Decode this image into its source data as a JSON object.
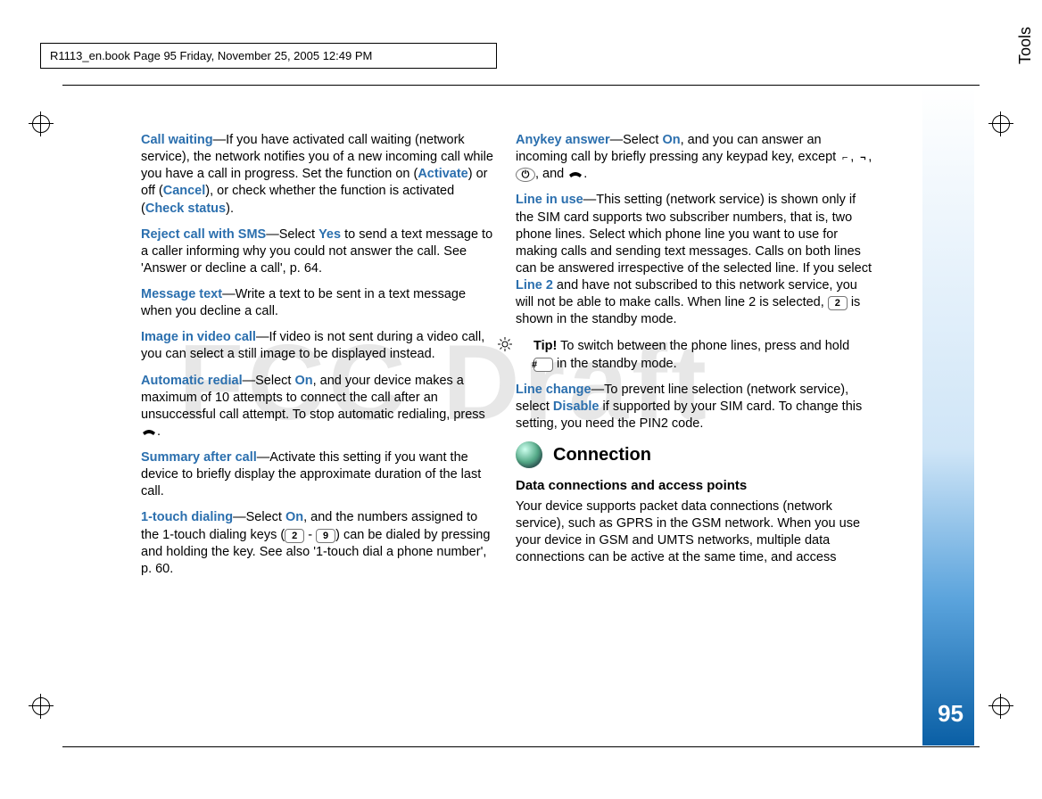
{
  "frame_header": "R1113_en.book  Page 95  Friday, November 25, 2005  12:49 PM",
  "watermark": "FCC Draft",
  "side": {
    "label": "Tools",
    "page": "95"
  },
  "col1": {
    "p1_term": "Call waiting",
    "p1_body": "—If you have activated call waiting (network service), the network notifies you of a new incoming call while you have a call in progress. Set the function on (",
    "p1_opt1": "Activate",
    "p1_mid1": ") or off (",
    "p1_opt2": "Cancel",
    "p1_mid2": "), or check whether the function is activated (",
    "p1_opt3": "Check status",
    "p1_end": ").",
    "p2_term": "Reject call with SMS",
    "p2_body": "—Select ",
    "p2_opt": "Yes",
    "p2_rest": " to send a text message to a caller informing why you could not answer the call. See 'Answer or decline a call', p. 64.",
    "p3_term": "Message text",
    "p3_body": "—Write a text to be sent in a text message when you decline a call.",
    "p4_term": "Image in video call",
    "p4_body": "—If video is not sent during a video call, you can select a still image to be displayed instead.",
    "p5_term": "Automatic redial",
    "p5_body": "—Select ",
    "p5_opt": "On",
    "p5_rest": ", and your device makes a maximum of 10 attempts to connect the call after an unsuccessful call attempt. To stop automatic redialing, press ",
    "p5_end": ".",
    "p6_term": "Summary after call",
    "p6_body": "—Activate this setting if you want the device to briefly display the approximate duration of the last call.",
    "p7_term": "1-touch dialing",
    "p7_body": "—Select ",
    "p7_opt": "On",
    "p7_mid1": ", and the numbers assigned to the 1-touch dialing keys (",
    "p7_key1": "2",
    "p7_mid2": " - ",
    "p7_key2": "9",
    "p7_rest": ") can be dialed by pressing and holding the key. See also '1-touch dial a phone number', p. 60."
  },
  "col2": {
    "p1_term": "Anykey answer",
    "p1_body": "—Select ",
    "p1_opt": "On",
    "p1_rest1": ", and you can answer an incoming call by briefly pressing any keypad key, except ",
    "p1_k1": "⌐",
    "p1_sep1": ", ",
    "p1_k2": "¬",
    "p1_sep2": ", ",
    "p1_k3": "⏻",
    "p1_sep3": ", and ",
    "p1_end": ".",
    "p2_term": "Line in use",
    "p2_body": "—This setting (network service) is shown only if the SIM card supports two subscriber numbers, that is, two phone lines. Select which phone line you want to use for making calls and sending text messages. Calls on both lines can be answered irrespective of the selected line. If you select ",
    "p2_opt": "Line 2",
    "p2_rest1": " and have not subscribed to this network service, you will not be able to make calls. When line 2 is selected, ",
    "p2_key": "2",
    "p2_rest2": " is shown in the standby mode.",
    "tip_label": "Tip!",
    "tip_body1": " To switch between the phone lines, press and hold ",
    "tip_key": "#",
    "tip_body2": " in the standby mode.",
    "p3_term": "Line change",
    "p3_body": "—To prevent line selection (network service), select ",
    "p3_opt": "Disable",
    "p3_rest": " if supported by your SIM card. To change this setting, you need the PIN2 code.",
    "sect_title": "Connection",
    "subhead": "Data connections and access points",
    "p4": "Your device supports packet data connections (network service), such as GPRS in the GSM network. When you use your device in GSM and UMTS networks, multiple data connections can be active at the same time, and access"
  }
}
